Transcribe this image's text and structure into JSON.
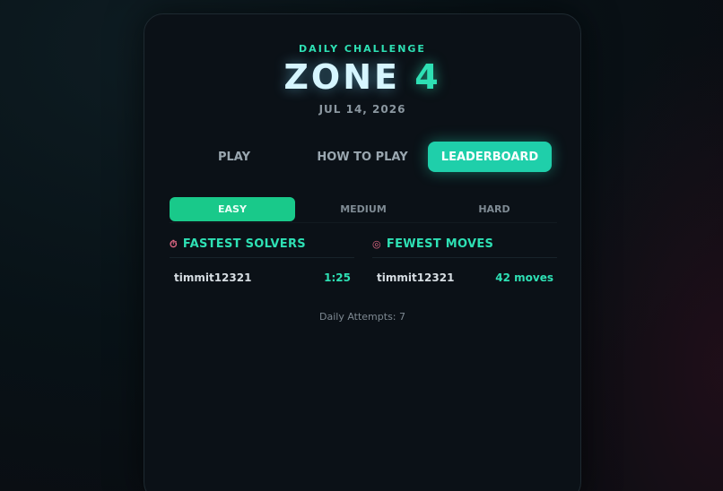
{
  "header": {
    "eyebrow": "DAILY CHALLENGE",
    "title_word": "ZONE",
    "title_number": "4",
    "date": "JUL 14, 2026"
  },
  "tabs": [
    {
      "label": "PLAY",
      "active": false
    },
    {
      "label": "HOW TO PLAY",
      "active": false
    },
    {
      "label": "LEADERBOARD",
      "active": true
    }
  ],
  "difficulty": [
    {
      "label": "EASY",
      "active": true
    },
    {
      "label": "MEDIUM",
      "active": false
    },
    {
      "label": "HARD",
      "active": false
    }
  ],
  "leaderboard": {
    "fastest": {
      "icon": "stopwatch-icon",
      "title": "FASTEST SOLVERS",
      "rows": [
        {
          "name": "timmit12321",
          "value": "1:25"
        }
      ]
    },
    "fewest": {
      "icon": "target-icon",
      "title": "FEWEST MOVES",
      "rows": [
        {
          "name": "timmit12321",
          "value": "42 moves"
        }
      ]
    }
  },
  "attempts": "Daily Attempts: 7",
  "colors": {
    "accent": "#2ee0b4",
    "active_tab": "#1fcfaa",
    "active_difficulty": "#19c98a"
  }
}
